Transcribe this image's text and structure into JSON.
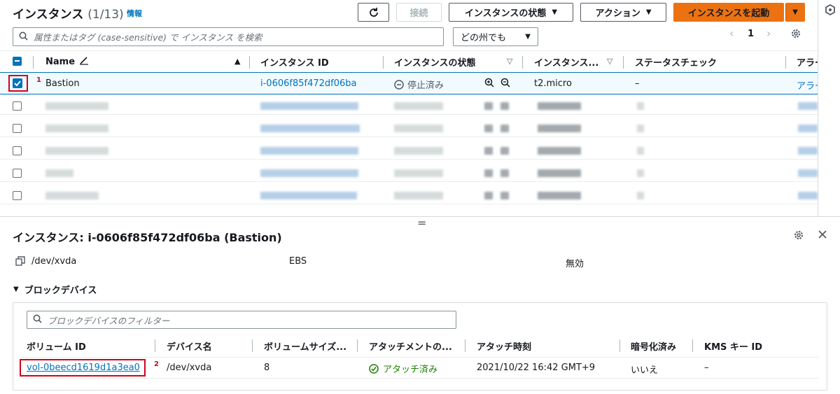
{
  "header": {
    "title": "インスタンス",
    "count": "(1/13)",
    "info": "情報",
    "connect_label": "接続",
    "state_label": "インスタンスの状態",
    "actions_label": "アクション",
    "launch_label": "インスタンスを起動"
  },
  "search": {
    "placeholder": "属性またはタグ (case-sensitive) で インスタンス を検索"
  },
  "region_select": {
    "value": "どの州でも"
  },
  "pagination": {
    "page": "1"
  },
  "table": {
    "columns": [
      "Name",
      "インスタンス ID",
      "インスタンスの状態",
      "インスタンス...",
      "ステータスチェック",
      "アラー"
    ],
    "selected_row": {
      "name": "Bastion",
      "id": "i-0606f85f472df06ba",
      "state": "停止済み",
      "type": "t2.micro",
      "status": "–",
      "alarm": "アラー"
    },
    "annotation": "1"
  },
  "detail": {
    "title": "インスタンス: i-0606f85f472df06ba (Bastion)",
    "root_device": "/dev/xvda",
    "root_type": "EBS",
    "ebs_opt": "無効",
    "section": "ブロックデバイス",
    "filter_placeholder": "ブロックデバイスのフィルター",
    "columns": [
      "ボリューム ID",
      "デバイス名",
      "ボリュームサイズ...",
      "アタッチメントの...",
      "アタッチ時刻",
      "暗号化済み",
      "KMS キー ID"
    ],
    "row": {
      "volume_id": "vol-0beecd1619d1a3ea0",
      "device": "/dev/xvda",
      "size": "8",
      "attachment": "アタッチ済み",
      "time": "2021/10/22 16:42 GMT+9",
      "encrypted": "いいえ",
      "kms": "–"
    },
    "annotation": "2"
  },
  "colors": {
    "accent": "#ec7211",
    "link": "#0073bb",
    "annotation": "#d0021b",
    "success": "#1d8102"
  }
}
